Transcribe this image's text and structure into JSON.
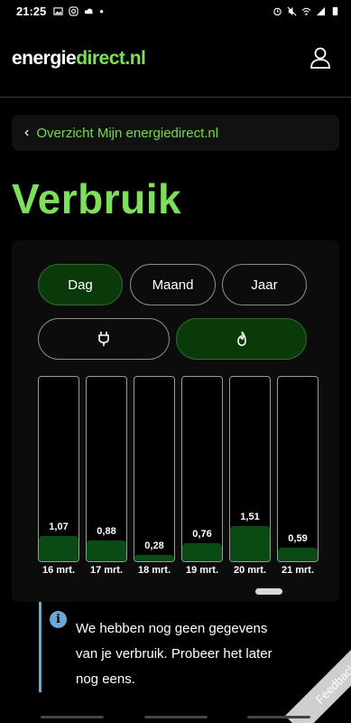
{
  "status": {
    "time": "21:25",
    "dot": "•"
  },
  "logo": {
    "part1": "energie",
    "part2": "direct.nl"
  },
  "breadcrumb": {
    "label": "Overzicht Mijn energiedirect.nl"
  },
  "page": {
    "title": "Verbruik"
  },
  "period_tabs": [
    {
      "label": "Dag",
      "active": true
    },
    {
      "label": "Maand",
      "active": false
    },
    {
      "label": "Jaar",
      "active": false
    }
  ],
  "energy_tabs": [
    {
      "icon": "plug-icon",
      "active": false
    },
    {
      "icon": "flame-icon",
      "active": true
    }
  ],
  "chart_data": {
    "type": "bar",
    "categories": [
      "16 mrt.",
      "17 mrt.",
      "18 mrt.",
      "19 mrt.",
      "20 mrt.",
      "21 mrt."
    ],
    "values": [
      1.07,
      0.88,
      0.28,
      0.76,
      1.51,
      0.59
    ],
    "value_labels": [
      "1,07",
      "0,88",
      "0,28",
      "0,76",
      "1,51",
      "0,59"
    ],
    "ylim": [
      0,
      8
    ]
  },
  "info": {
    "message": "We hebben nog geen gegevens van je verbruik. Probeer het later nog eens."
  },
  "feedback": {
    "label": "Feedback"
  },
  "colors": {
    "accent": "#7ee05a",
    "active_bg": "#0a3a0a",
    "bar_fill": "#0a4a14",
    "info": "#6aa8d8"
  }
}
